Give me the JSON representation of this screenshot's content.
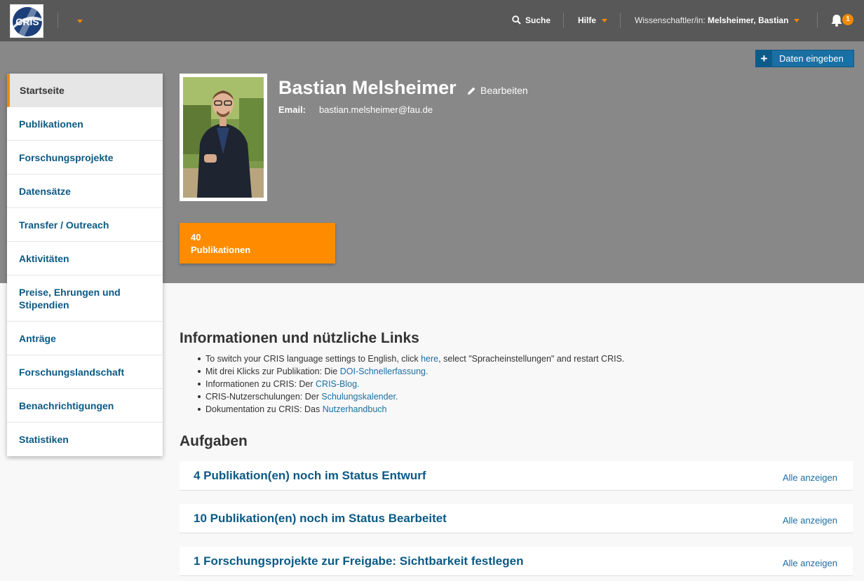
{
  "topbar": {
    "logo_text": "CRIS",
    "search_label": "Suche",
    "help_label": "Hilfe",
    "role_label": "Wissenschaftler/in:",
    "user_name": "Melsheimer, Bastian",
    "notification_count": "1",
    "icons": [
      "cris-logo",
      "chevron-down-icon",
      "search-icon",
      "bell-icon"
    ],
    "accent_color": "#f18a00"
  },
  "hero": {
    "add_button_label": "Daten eingeben",
    "name": "Bastian Melsheimer",
    "edit_label": "Bearbeiten",
    "email_label": "Email:",
    "email_value": "bastian.melsheimer@fau.de",
    "pub_count": "40",
    "pub_label": "Publikationen",
    "tile_color": "#ff8c00"
  },
  "sidebar": {
    "items": [
      {
        "label": "Startseite"
      },
      {
        "label": "Publikationen"
      },
      {
        "label": "Forschungsprojekte"
      },
      {
        "label": "Datensätze"
      },
      {
        "label": "Transfer / Outreach"
      },
      {
        "label": "Aktivitäten"
      },
      {
        "label": "Preise, Ehrungen und Stipendien"
      },
      {
        "label": "Anträge"
      },
      {
        "label": "Forschungslandschaft"
      },
      {
        "label": "Benachrichtigungen"
      },
      {
        "label": "Statistiken"
      }
    ]
  },
  "info": {
    "title": "Informationen und nützliche Links",
    "items": [
      {
        "pre": "To switch your CRIS language settings to English, click ",
        "link": "here",
        "post": ", select \"Spracheinstellungen\" and restart CRIS."
      },
      {
        "pre": "Mit drei Klicks zur Publikation: Die ",
        "link": "DOI-Schnellerfassung.",
        "post": ""
      },
      {
        "pre": "Informationen zu CRIS: Der ",
        "link": "CRIS-Blog.",
        "post": ""
      },
      {
        "pre": "CRIS-Nutzerschulungen: Der ",
        "link": "Schulungskalender.",
        "post": ""
      },
      {
        "pre": "Dokumentation zu CRIS: Das ",
        "link": "Nutzerhandbuch",
        "post": ""
      }
    ]
  },
  "tasks": {
    "title": "Aufgaben",
    "items": [
      {
        "title": "4 Publikation(en) noch im Status Entwurf",
        "action": "Alle anzeigen"
      },
      {
        "title": "10 Publikation(en) noch im Status Bearbeitet",
        "action": "Alle anzeigen"
      },
      {
        "title": "1 Forschungsprojekte zur Freigabe: Sichtbarkeit festlegen",
        "action": "Alle anzeigen"
      }
    ]
  }
}
